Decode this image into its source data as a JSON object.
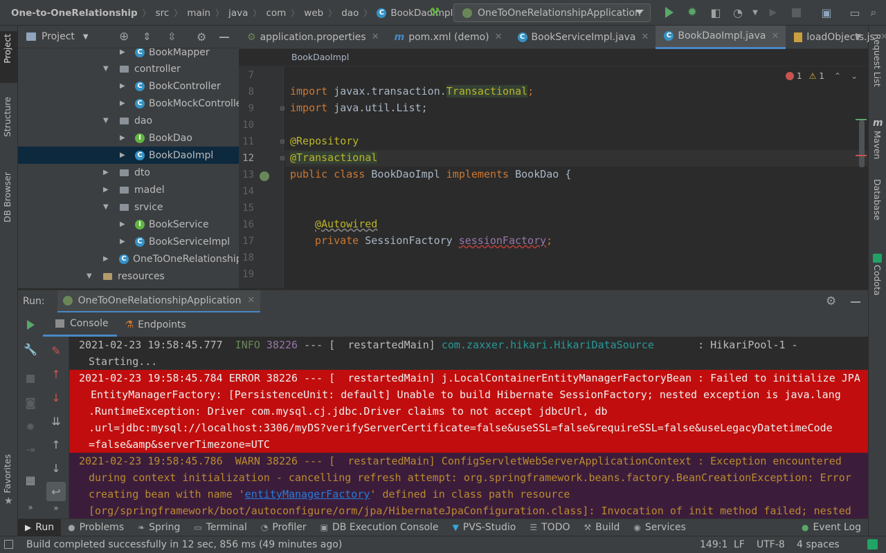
{
  "nav": {
    "crumbs": [
      "One-to-OneRelationship",
      "src",
      "main",
      "java",
      "com",
      "web",
      "dao",
      "BookDaoImpl"
    ],
    "run_config": "OneToOneRelationshipApplication"
  },
  "left_strip": {
    "tabs": [
      "Project",
      "Structure",
      "DB Browser",
      "Favorites"
    ]
  },
  "right_strip": {
    "tabs": [
      "Request List",
      "Maven",
      "Database",
      "Codota"
    ]
  },
  "project": {
    "title": "Project",
    "tree": [
      {
        "label": "BookMapper",
        "type": "class"
      },
      {
        "label": "controller",
        "type": "folder"
      },
      {
        "label": "BookController",
        "type": "class"
      },
      {
        "label": "BookMockControlle",
        "type": "class"
      },
      {
        "label": "dao",
        "type": "folder"
      },
      {
        "label": "BookDao",
        "type": "interface"
      },
      {
        "label": "BookDaoImpl",
        "type": "class"
      },
      {
        "label": "dto",
        "type": "folder"
      },
      {
        "label": "madel",
        "type": "folder"
      },
      {
        "label": "srvice",
        "type": "folder"
      },
      {
        "label": "BookService",
        "type": "interface"
      },
      {
        "label": "BookServiceImpl",
        "type": "class"
      },
      {
        "label": "OneToOneRelationship",
        "type": "app"
      },
      {
        "label": "resources",
        "type": "folder"
      }
    ]
  },
  "editor": {
    "tabs": [
      "application.properties",
      "pom.xml (demo)",
      "BookServiceImpl.java",
      "BookDaoImpl.java",
      "loadObjects.js"
    ],
    "active_tab": "BookDaoImpl.java",
    "breadcrumb": "BookDaoImpl",
    "errors": "1",
    "warnings": "1",
    "line_numbers": [
      "7",
      "8",
      "9",
      "10",
      "11",
      "12",
      "13",
      "14",
      "15",
      "16",
      "17",
      "18",
      "19"
    ],
    "code": {
      "l8_kw": "import ",
      "l8_pkg": "javax.transaction.",
      "l8_cls": "Transactional",
      "l8_end": ";",
      "l9_kw": "import ",
      "l9_rest": "java.util.List;",
      "l11": "@Repository",
      "l12": "@Transactional",
      "l13_kw1": "public class ",
      "l13_name": "BookDaoImpl ",
      "l13_kw2": "implements ",
      "l13_rest": "BookDao {",
      "l16": "@Autowired",
      "l17_kw": "private ",
      "l17_type": "SessionFactory ",
      "l17_field": "sessionFactory",
      "l17_end": ";"
    }
  },
  "run": {
    "label": "Run:",
    "app_tab": "OneToOneRelationshipApplication",
    "sub_tabs": [
      "Console",
      "Endpoints"
    ]
  },
  "console": {
    "info_ts": "2021-02-23 19:58:45.777",
    "info_level": "  INFO",
    "info_pid": " 38226",
    "info_mid": " --- [  restartedMain] ",
    "info_logger": "com.zaxxer.hikari.HikariDataSource",
    "info_msg": "       : HikariPool-1 -",
    "info_cont": "Starting...",
    "err_lines": [
      "2021-02-23 19:58:45.784 ERROR 38226 --- [  restartedMain] j.LocalContainerEntityManagerFactoryBean : Failed to initialize JPA",
      " EntityManagerFactory: [PersistenceUnit: default] Unable to build Hibernate SessionFactory; nested exception is java.lang",
      ".RuntimeException: Driver com.mysql.cj.jdbc.Driver claims to not accept jdbcUrl, db",
      ".url=jdbc:mysql://localhost:3306/myDS?verifyServerCertificate=false&useSSL=false&requireSSL=false&useLegacyDatetimeCode",
      "=false&amp&serverTimezone=UTC"
    ],
    "warn_line1": "2021-02-23 19:58:45.786  WARN 38226 --- [  restartedMain] ConfigServletWebServerApplicationContext : Exception encountered",
    "warn_line2": "during context initialization - cancelling refresh attempt: org.springframework.beans.factory.BeanCreationException: Error",
    "warn_line3_pre": "creating bean with name '",
    "warn_line3_link": "entityManagerFactory",
    "warn_line3_post": "' defined in class path resource",
    "warn_line4": "[org/springframework/boot/autoconfigure/orm/jpa/HibernateJpaConfiguration.class]: Invocation of init method failed; nested"
  },
  "bottom_tabs": [
    "Run",
    "Problems",
    "Spring",
    "Terminal",
    "Profiler",
    "DB Execution Console",
    "PVS-Studio",
    "TODO",
    "Build",
    "Services",
    "Event Log"
  ],
  "status": {
    "message": "Build completed successfully in 12 sec, 856 ms (49 minutes ago)",
    "position": "149:1",
    "line_sep": "LF",
    "encoding": "UTF-8",
    "indent": "4 spaces"
  },
  "colors": {
    "error_bg": "#c10d0d",
    "warn_fg": "#bc8b2f",
    "link": "#287bde",
    "accent": "#4a88c7"
  }
}
